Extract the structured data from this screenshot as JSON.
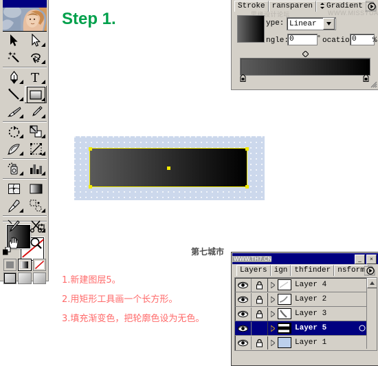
{
  "app": {
    "step_title": "Step 1.",
    "watermark_city": "第七城市"
  },
  "toolbox": {
    "name": "Toolbox",
    "tools": [
      {
        "row": 0,
        "left": "selection-tool",
        "right": "direct-selection-tool"
      },
      {
        "row": 1,
        "left": "magic-wand-tool",
        "right": "lasso-tool"
      },
      {
        "row": 2,
        "left": "pen-tool",
        "right": "type-tool"
      },
      {
        "row": 3,
        "left": "line-segment-tool",
        "right": "rectangle-tool"
      },
      {
        "row": 4,
        "left": "paintbrush-tool",
        "right": "pencil-tool"
      },
      {
        "row": 5,
        "left": "rotate-tool",
        "right": "scale-tool"
      },
      {
        "row": 6,
        "left": "warp-tool",
        "right": "free-transform-tool"
      },
      {
        "row": 7,
        "left": "symbol-sprayer-tool",
        "right": "column-graph-tool"
      },
      {
        "row": 8,
        "left": "mesh-tool",
        "right": "gradient-tool"
      },
      {
        "row": 9,
        "left": "eyedropper-tool",
        "right": "blend-tool"
      },
      {
        "row": 10,
        "left": "slice-tool",
        "right": "scissors-tool"
      },
      {
        "row": 11,
        "left": "hand-tool",
        "right": "zoom-tool"
      }
    ],
    "selected_tool": "rectangle-tool",
    "fill_label": "Fill",
    "stroke_label": "Stroke (None)",
    "fill_mode": "gradient",
    "screen_mode": "standard"
  },
  "gradient_panel": {
    "tabs": [
      {
        "label": "Stroke",
        "active": false
      },
      {
        "label": "ransparen",
        "active": false
      },
      {
        "label": "Gradient",
        "active": true
      }
    ],
    "watermark_cn": "思缘设计论坛",
    "watermark_url": "WWW.MISSYUAN.COM",
    "type_label": "ype:",
    "type_value": "Linear",
    "angle_label": "ngle:",
    "angle_value": "0",
    "angle_unit": "°",
    "location_label": "ocation:",
    "location_value": "0",
    "location_unit": "%",
    "gradient_stops": [
      {
        "position": 0,
        "color": "#646464"
      },
      {
        "position": 100,
        "color": "#000000"
      }
    ],
    "midpoint": 50
  },
  "layers_panel": {
    "title_watermark": "WWW.TH7.CN",
    "minimize_label": "_",
    "close_label": "×",
    "tabs": [
      {
        "label": "Layers",
        "active": true
      },
      {
        "label": "ign",
        "active": false
      },
      {
        "label": "thfinder",
        "active": false
      },
      {
        "label": "nsform",
        "active": false
      }
    ],
    "rows": [
      {
        "name": "Layer 4",
        "visible": true,
        "locked": true,
        "selected": false,
        "thumb": "#ffffff",
        "swatch": null
      },
      {
        "name": "Layer 2",
        "visible": true,
        "locked": true,
        "selected": false,
        "thumb": "#ffffff",
        "swatch": null
      },
      {
        "name": "Layer 3",
        "visible": true,
        "locked": true,
        "selected": false,
        "thumb": "#ffffff",
        "swatch": null
      },
      {
        "name": "Layer 5",
        "visible": true,
        "locked": false,
        "selected": true,
        "thumb": "#000000",
        "swatch": "#ffe400"
      },
      {
        "name": "Layer 1",
        "visible": true,
        "locked": true,
        "selected": false,
        "thumb": "#bcd0ec",
        "swatch": null
      }
    ]
  },
  "artboard": {
    "background": "#ccd8ec",
    "shape": {
      "name": "gradient-rectangle",
      "fill_start": "#5a5a5a",
      "fill_end": "#000000",
      "selection_color": "#f2ea00"
    }
  },
  "instructions": [
    "1.新建图层5。",
    "2.用矩形工具画一个长方形。",
    "3.填充渐变色，把轮廓色设为无色。"
  ]
}
